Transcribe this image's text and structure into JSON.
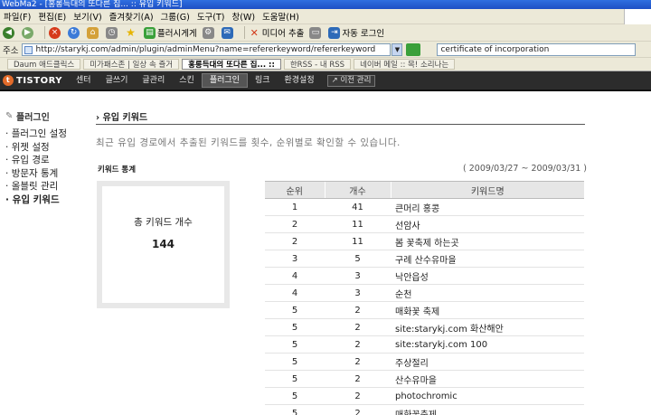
{
  "window": {
    "title": "WebMa2 - [홍롱득대의 또다른 집... :: 유입 키워드]"
  },
  "menu": [
    "파일(F)",
    "편집(E)",
    "보기(V)",
    "즐겨찾기(A)",
    "그룹(G)",
    "도구(T)",
    "창(W)",
    "도움말(H)"
  ],
  "toolbar": {
    "scrap_label": "플러시게게",
    "media_label": "미디어 추출",
    "autologin_label": "자동 로그인"
  },
  "address": {
    "label": "주소",
    "url": "http://starykj.com/admin/plugin/adminMenu?name=refererkeyword/refererkeyword",
    "search_value": "certificate of incorporation"
  },
  "bookmarks": [
    "Daum 애드클릭스",
    "미가패스존 | 일상 속 즐거",
    "홍롱득대의 또다른 집... ::",
    "한RSS - 내 RSS",
    "네이버 메일 :: 목! 소리나는"
  ],
  "nav": {
    "logo": "TISTORY",
    "items": [
      "센터",
      "글쓰기",
      "글관리",
      "스킨",
      "플러그인",
      "링크",
      "환경설정"
    ],
    "active_index": 4,
    "prev_label": "이전 관리"
  },
  "sidebar": {
    "heading": "플러그인",
    "items": [
      "플러그인 설정",
      "위젯 설정",
      "유입 경로",
      "방문자 통계",
      "올블릿 관리",
      "유입 키워드"
    ],
    "current_index": 5
  },
  "main": {
    "title": "유입 키워드",
    "description": "최근 유입 경로에서 추출된 키워드를 횟수, 순위별로 확인할 수 있습니다.",
    "stat_label": "키워드 통계",
    "date_range": "( 2009/03/27 ~ 2009/03/31 )",
    "total_label": "총 키워드 개수",
    "total_value": "144",
    "table": {
      "headers": [
        "순위",
        "개수",
        "키워드명"
      ],
      "rows": [
        [
          "1",
          "41",
          "큰머리 홍콩"
        ],
        [
          "2",
          "11",
          "선암사"
        ],
        [
          "2",
          "11",
          "봄 꽃축제 하는곳"
        ],
        [
          "3",
          "5",
          "구례 산수유마을"
        ],
        [
          "4",
          "3",
          "낙안읍성"
        ],
        [
          "4",
          "3",
          "순천"
        ],
        [
          "5",
          "2",
          "매화꽃 축제"
        ],
        [
          "5",
          "2",
          "site:starykj.com 화산해안"
        ],
        [
          "5",
          "2",
          "site:starykj.com 100"
        ],
        [
          "5",
          "2",
          "주상절리"
        ],
        [
          "5",
          "2",
          "산수유마을"
        ],
        [
          "5",
          "2",
          "photochromic"
        ],
        [
          "5",
          "2",
          "매화꽃축제"
        ]
      ]
    }
  }
}
